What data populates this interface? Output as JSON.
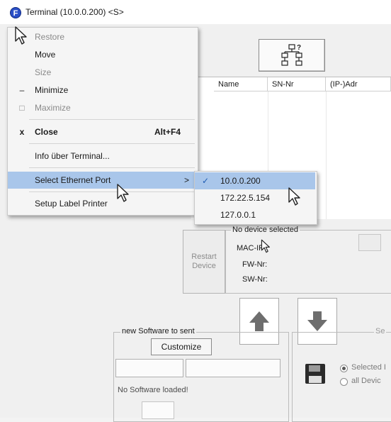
{
  "window": {
    "title": "Terminal (10.0.0.200) <S>",
    "app_icon_glyph": "F"
  },
  "system_menu": {
    "items": [
      {
        "label": "Restore",
        "disabled": true,
        "glyph": "",
        "accel": ""
      },
      {
        "label": "Move",
        "disabled": false,
        "glyph": "",
        "accel": ""
      },
      {
        "label": "Size",
        "disabled": true,
        "glyph": "",
        "accel": ""
      },
      {
        "label": "Minimize",
        "disabled": false,
        "glyph": "‒",
        "accel": ""
      },
      {
        "label": "Maximize",
        "disabled": true,
        "glyph": "□",
        "accel": ""
      },
      {
        "label": "Close",
        "disabled": false,
        "glyph": "x",
        "accel": "Alt+F4"
      },
      {
        "label": "Info über Terminal...",
        "disabled": false,
        "glyph": "",
        "accel": ""
      },
      {
        "label": "Select Ethernet Port",
        "disabled": false,
        "glyph": "",
        "accel": "",
        "submenu_arrow": ">"
      },
      {
        "label": "Setup Label Printer",
        "disabled": false,
        "glyph": "",
        "accel": ""
      }
    ]
  },
  "ethernet_submenu": {
    "items": [
      {
        "label": "10.0.0.200",
        "checked": true,
        "check": "✓"
      },
      {
        "label": "172.22.5.154",
        "checked": false,
        "check": ""
      },
      {
        "label": "127.0.0.1",
        "checked": false,
        "check": ""
      }
    ]
  },
  "device_table": {
    "columns": [
      "Name",
      "SN-Nr",
      "(IP-)Adr"
    ]
  },
  "device_panel": {
    "restart_label": "Restart\nDevice",
    "status": "No device selected",
    "fields": [
      "MAC-IP",
      "FW-Nr:",
      "SW-Nr:"
    ]
  },
  "software_panel": {
    "group_title": "new Software to sent",
    "customize_label": "Customize",
    "status": "No Software loaded!",
    "send_group_title": "Se",
    "radio_options": [
      {
        "label": "Selected I",
        "selected": true
      },
      {
        "label": "all Devic",
        "selected": false
      }
    ]
  },
  "colors": {
    "highlight": "#a9c6ea",
    "check": "#1e5cb3",
    "app_icon": "#2a4fc7"
  },
  "icons": [
    "app-icon",
    "network-search-icon",
    "up-arrow-icon",
    "down-arrow-icon",
    "floppy-disk-icon",
    "checkmark-icon",
    "mouse-pointer-icon"
  ]
}
